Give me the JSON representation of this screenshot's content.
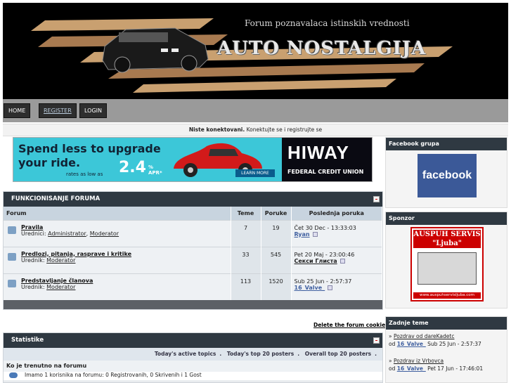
{
  "header": {
    "tagline": "Forum poznavalaca istinskih vrednosti",
    "logo": "AUTO NOSTALGIJA"
  },
  "nav": {
    "home": "HOME",
    "register": "REGISTER",
    "login": "LOGIN"
  },
  "connection": {
    "status": "Niste konektovani.",
    "hint": "Konektujte se i registrujte se"
  },
  "ad": {
    "line1": "Spend less to upgrade",
    "line2": "your ride.",
    "rates": "rates as low as",
    "rate": "2.4",
    "percent": "%",
    "apr": "APR*",
    "learn": "LEARN MORE",
    "brand": "HIWAY",
    "brand_sub": "FEDERAL CREDIT UNION"
  },
  "forum_block": {
    "title": "FUNKCIONISANJE FORUMA",
    "columns": [
      "Forum",
      "Teme",
      "Poruke",
      "Poslednja poruka"
    ],
    "rows": [
      {
        "title": "Pravila",
        "mods_label": "Urednici:",
        "mods": [
          "Administrator",
          "Moderator"
        ],
        "topics": "7",
        "posts": "19",
        "last_date": "Čet 30 Dec - 13:33:03",
        "last_user": "Ryan"
      },
      {
        "title": "Predlozi, pitanja, rasprave i kritike",
        "mods_label": "Urednik:",
        "mods": [
          "Moderator"
        ],
        "topics": "33",
        "posts": "545",
        "last_date": "Pet 20 Maj - 23:00:46",
        "last_user": "Секси Глиста"
      },
      {
        "title": "Predstavljanje članova",
        "mods_label": "Urednik:",
        "mods": [
          "Moderator"
        ],
        "topics": "113",
        "posts": "1520",
        "last_date": "Sub 25 Jun - 2:57:37",
        "last_user": "16_Valve_"
      }
    ]
  },
  "delete_cookies": "Delete the forum cookies",
  "stats": {
    "title": "Statistike",
    "links": [
      "Today's active topics",
      "Today's top 20 posters",
      "Overall top 20 posters"
    ],
    "online_title": "Ko je trenutno na forumu",
    "online_text": "Imamo 1 korisnika na forumu: 0 Registrovanih, 0 Skrivenih i 1 Gost"
  },
  "sidebar": {
    "facebook_title": "Facebook grupa",
    "facebook_logo": "facebook",
    "sponsor_title": "Sponzor",
    "sponsor_name": "AUSPUH SERVIS",
    "sponsor_sub": "\"Ljuba\"",
    "sponsor_url": "www.auspuhservisljuba.com",
    "topics_title": "Zadnje teme",
    "topics": [
      {
        "title": "Pozdrav od dareKadetc",
        "from": "od",
        "user": "16_Valve_",
        "date": "Sub 25 Jun - 2:57:37"
      },
      {
        "title": "Pozdrav iz Vrbovca",
        "from": "od",
        "user": "16_Valve_",
        "date": "Pet 17 Jun - 17:46:01"
      }
    ]
  }
}
